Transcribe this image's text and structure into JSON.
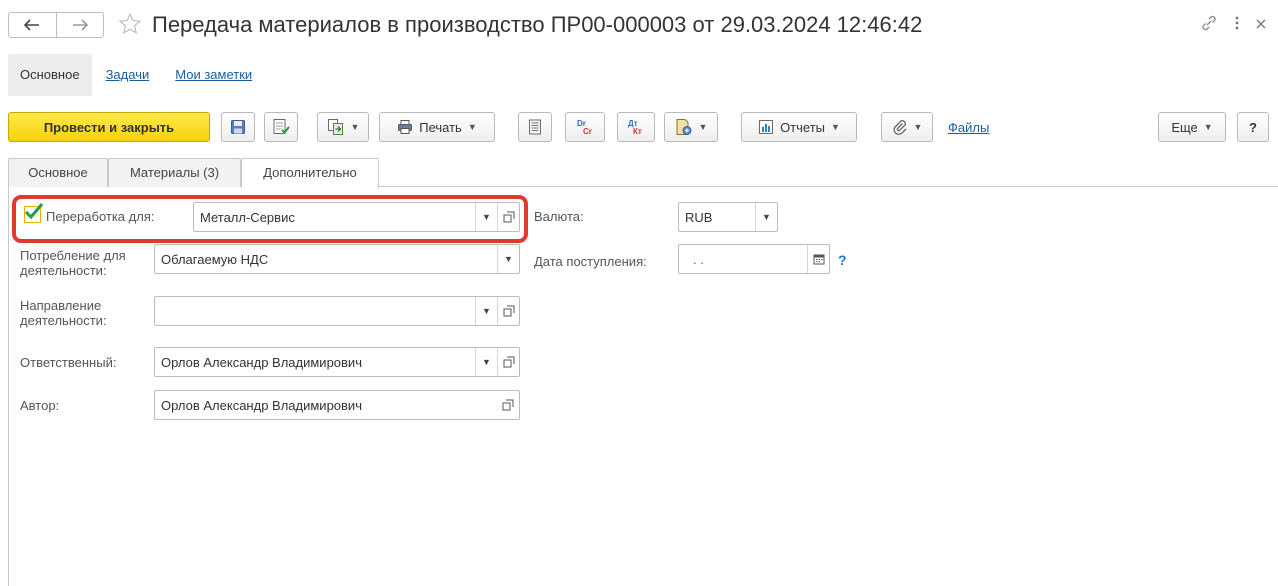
{
  "title": "Передача материалов в производство ПР00-000003 от 29.03.2024 12:46:42",
  "section_tabs": [
    "Основное",
    "Задачи",
    "Мои заметки"
  ],
  "toolbar": {
    "post_close": "Провести и закрыть",
    "print": "Печать",
    "reports": "Отчеты",
    "files": "Файлы",
    "more": "Еще",
    "help": "?",
    "dr_icon": [
      "Dr",
      "Cr"
    ],
    "dt_icon": [
      "Дт",
      "Кт"
    ]
  },
  "page_tabs": [
    "Основное",
    "Материалы (3)",
    "Дополнительно"
  ],
  "form": {
    "processing_for_label": "Переработка для:",
    "processing_for_checked": true,
    "processing_for_value": "Металл-Сервис",
    "consumption_label": "Потребление для деятельности:",
    "consumption_value": "Облагаемую НДС",
    "direction_label": "Направление деятельности:",
    "direction_value": "",
    "responsible_label": "Ответственный:",
    "responsible_value": "Орлов Александр Владимирович",
    "author_label": "Автор:",
    "author_value": "Орлов Александр Владимирович",
    "currency_label": "Валюта:",
    "currency_value": "RUB",
    "receipt_date_label": "Дата поступления:",
    "receipt_date_value": ". .",
    "help_mark": "?"
  },
  "colors": {
    "primary_button": "#f6d20a",
    "link": "#1a5d9e",
    "highlight": "#e03a2f",
    "checkmark": "#2e9a3e"
  },
  "icons": [
    "back-arrow-icon",
    "forward-arrow-icon",
    "star-icon",
    "link-icon",
    "more-vertical-icon",
    "close-icon",
    "save-icon",
    "post-icon",
    "related-docs-icon",
    "printer-icon",
    "journal-icon",
    "dr-cr-icon",
    "dt-kt-icon",
    "create-based-icon",
    "reports-icon",
    "paperclip-icon",
    "open-icon",
    "calendar-icon",
    "checkmark-icon"
  ]
}
